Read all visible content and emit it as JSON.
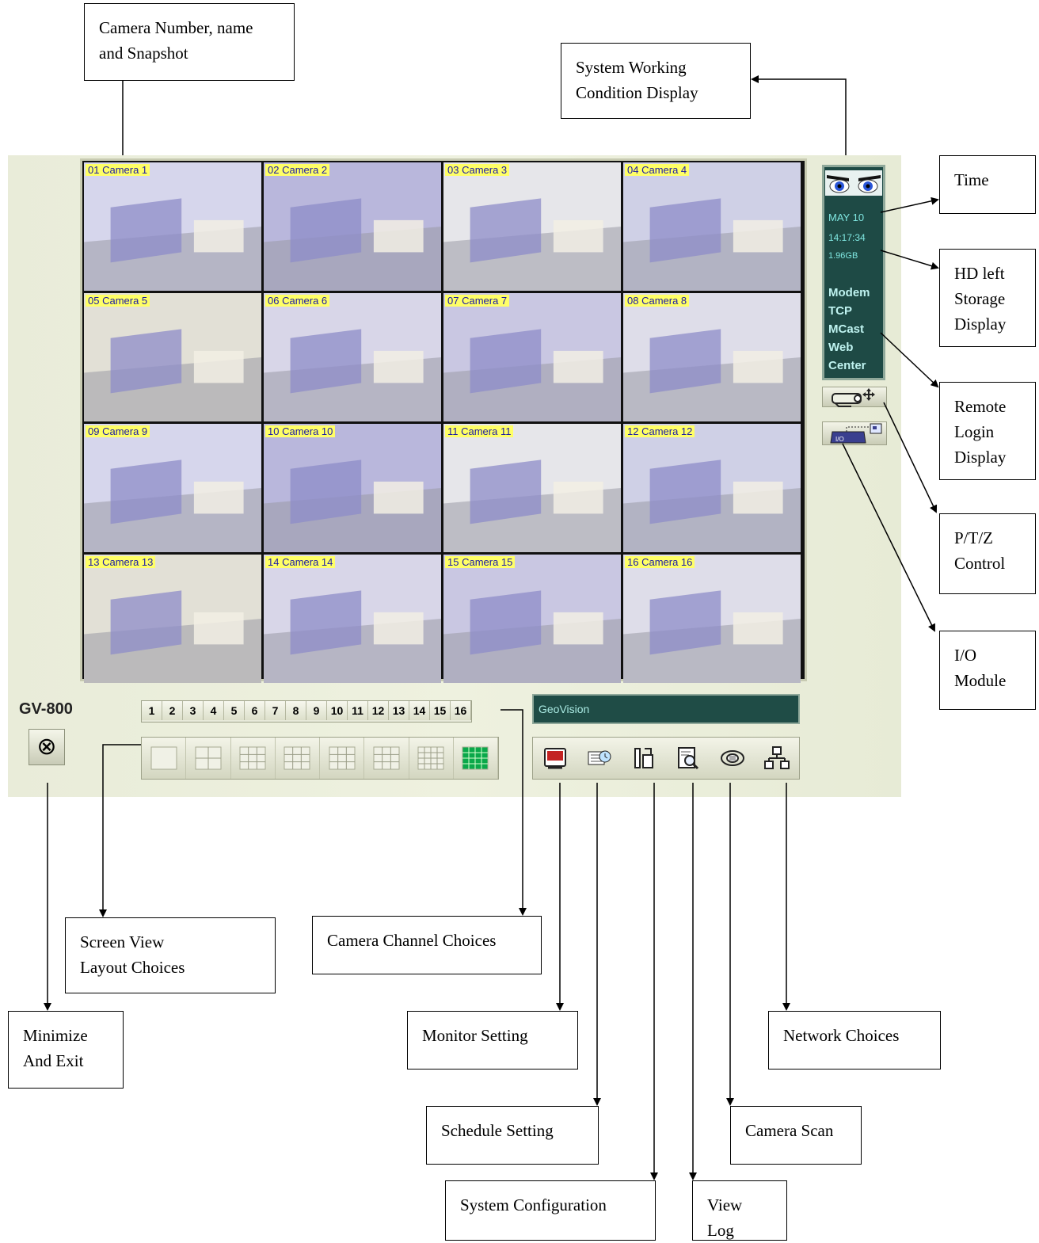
{
  "app": {
    "brand": "GV-800",
    "exit_icon": "⊗",
    "message_bar": "GeoVision",
    "status": {
      "date": "MAY 10",
      "time": "14:17:34",
      "hd_left": "1.96GB",
      "network": [
        "Modem",
        "TCP",
        "MCast",
        "Web",
        "Center"
      ]
    },
    "cameras": [
      "01 Camera 1",
      "02 Camera 2",
      "03 Camera 3",
      "04 Camera 4",
      "05 Camera 5",
      "06 Camera 6",
      "07 Camera 7",
      "08 Camera 8",
      "09 Camera 9",
      "10 Camera 10",
      "11 Camera 11",
      "12 Camera 12",
      "13 Camera 13",
      "14 Camera 14",
      "15 Camera 15",
      "16 Camera 16"
    ],
    "channels": [
      "1",
      "2",
      "3",
      "4",
      "5",
      "6",
      "7",
      "8",
      "9",
      "10",
      "11",
      "12",
      "13",
      "14",
      "15",
      "16"
    ],
    "layouts": [
      "layout-1-icon",
      "layout-4-icon",
      "layout-6-icon",
      "layout-8-icon",
      "layout-9-icon",
      "layout-10-icon",
      "layout-13-icon",
      "layout-16-icon"
    ],
    "tools": [
      "monitor-rec-icon",
      "schedule-icon",
      "config-tools-icon",
      "view-log-icon",
      "camera-scan-icon",
      "network-icon"
    ],
    "side_buttons": [
      "ptz-control-icon",
      "io-module-icon"
    ],
    "io_text": "I/O"
  },
  "callouts": {
    "camera_number": "Camera Number, name\nand Snapshot",
    "system_condition": "System Working\nCondition Display",
    "time": "Time",
    "hd_left": "HD left\nStorage\nDisplay",
    "remote_login": "Remote\nLogin\nDisplay",
    "ptz": "P/T/Z\nControl",
    "io": "I/O\nModule",
    "screen_view": "Screen View\nLayout Choices",
    "channel_choices": "Camera Channel Choices",
    "minimize": "Minimize\nAnd Exit",
    "monitor": "Monitor Setting",
    "network": "Network Choices",
    "schedule": "Schedule Setting",
    "camera_scan": "Camera Scan",
    "system_config": "System Configuration",
    "view_log": "View Log"
  },
  "colors": {
    "panel_bg": "#e9ecd9",
    "status_bg": "#1e4a45",
    "camera_label_bg": "#ffff66",
    "camera_label_text": "#1a1aa8",
    "active_layout": "#0aa84a"
  }
}
